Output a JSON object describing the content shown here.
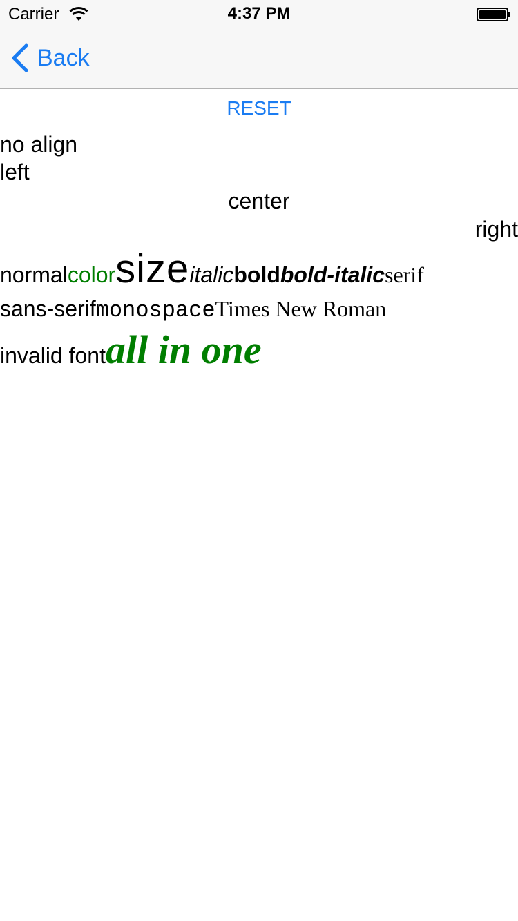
{
  "status_bar": {
    "carrier": "Carrier",
    "time": "4:37 PM",
    "icons": [
      "wifi-icon",
      "battery-icon"
    ]
  },
  "nav_bar": {
    "back_label": "Back",
    "back_icon": "chevron-left-icon",
    "accent_color": "#1a7cf2"
  },
  "content": {
    "reset_label": "RESET",
    "no_align": "no align",
    "left": "left",
    "center": "center",
    "right": "right",
    "styles": {
      "normal": "normal",
      "color": "color",
      "size": "size",
      "italic": "italic",
      "bold": "bold",
      "bold_italic": "bold-italic",
      "serif": "serif"
    },
    "fonts": {
      "sans_serif": "sans-serif",
      "monospace": "monospace",
      "times_new_roman": "Times New Roman"
    },
    "invalid_font": "invalid font",
    "all_in_one": "all in one",
    "green_color": "#007e00"
  }
}
